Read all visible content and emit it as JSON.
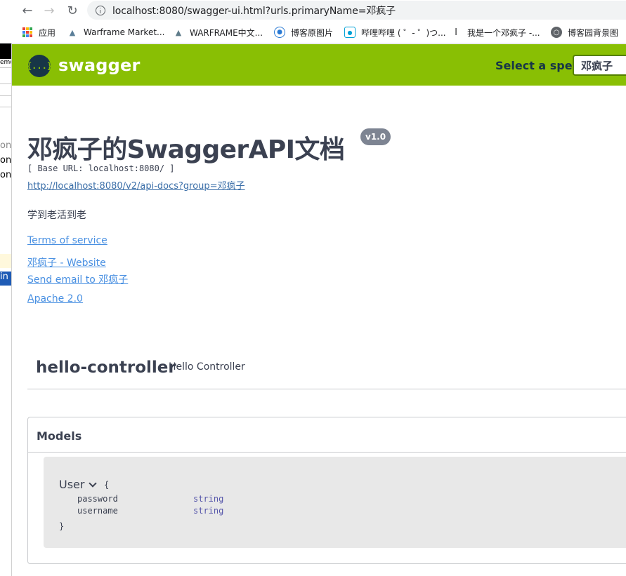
{
  "browser": {
    "url": "localhost:8080/swagger-ui.html?urls.primaryName=邓疯子",
    "bookmarks": [
      {
        "label": "应用",
        "icon": "apps-grid-icon"
      },
      {
        "label": "Warframe Market...",
        "icon": "warframe-market-icon"
      },
      {
        "label": "WARFRAME中文...",
        "icon": "warframe-icon"
      },
      {
        "label": "博客原图片",
        "icon": "blog-image-icon"
      },
      {
        "label": "哔哩哔哩 ( ゜- ゜)つ...",
        "icon": "bilibili-icon"
      },
      {
        "label": "我是一个邓疯子 -...",
        "icon": "cnblogs-icon"
      },
      {
        "label": "博客园背景图",
        "icon": "globe-icon"
      }
    ]
  },
  "left_strip": {
    "texts": [
      "emo",
      "on",
      "on",
      "on",
      "in"
    ]
  },
  "topbar": {
    "logo_text": "{...}",
    "brand": "swagger",
    "select_label": "Select a spec",
    "select_value": "邓疯子"
  },
  "info": {
    "title": "邓疯子的SwaggerAPI文档",
    "version": "v1.0",
    "base_url": "[ Base URL: localhost:8080/ ]",
    "api_docs_link": "http://localhost:8080/v2/api-docs?group=邓疯子",
    "description": "学到老活到老",
    "terms_link": "Terms of service",
    "website_link": "邓疯子 - Website",
    "email_link": "Send email to 邓疯子",
    "license_link": "Apache 2.0"
  },
  "tag": {
    "name": "hello-controller",
    "description": "Hello Controller"
  },
  "models": {
    "title": "Models",
    "model_name": "User",
    "open_brace": "{",
    "close_brace": "}",
    "properties": [
      {
        "name": "password",
        "type": "string"
      },
      {
        "name": "username",
        "type": "string"
      }
    ]
  },
  "colors": {
    "swagger_green": "#89bf04",
    "text_dark": "#3b4151",
    "link_blue": "#4990e2"
  }
}
